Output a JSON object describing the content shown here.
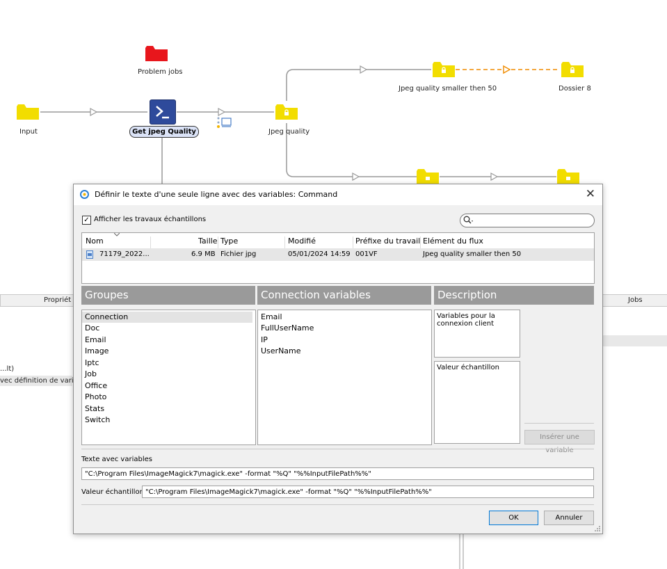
{
  "flow": {
    "problem_jobs": "Problem jobs",
    "input": "Input",
    "get_jpeg_quality": "Get jpeg Quality",
    "jpeg_quality": "Jpeg quality",
    "jpeg_smaller": "Jpeg quality smaller then 50",
    "dossier8": "Dossier 8"
  },
  "background": {
    "properties_header": "Propriét",
    "jobs_header": "Jobs",
    "left_text1": "...lt)",
    "left_text2": "vec définition de varia"
  },
  "dialog": {
    "title": "Définir le texte d'une seule ligne avec des variables: Command",
    "show_samples_label": "Afficher les travaux échantillons",
    "show_samples_checked": "✓",
    "search_placeholder": "",
    "columns": [
      "Nom",
      "Taille",
      "Type",
      "Modifié",
      "Préfixe du travail",
      "Elément du flux"
    ],
    "row": {
      "name": "71179_2022...",
      "size": "6.9 MB",
      "type": "Fichier jpg",
      "modified": "05/01/2024 14:59",
      "prefix": "001VF",
      "element": "Jpeg quality smaller then 50"
    },
    "groups_header": "Groupes",
    "variables_header": "Connection variables",
    "description_header": "Description",
    "groups": [
      "Connection",
      "Doc",
      "Email",
      "Image",
      "Iptc",
      "Job",
      "Office",
      "Photo",
      "Stats",
      "Switch"
    ],
    "variables": [
      "Email",
      "FullUserName",
      "IP",
      "UserName"
    ],
    "description_text": "Variables pour la connexion client",
    "sample_value_label": "Valeur échantillon",
    "insert_variable": "Insérer une variable",
    "text_with_variables_label": "Texte avec variables",
    "text_with_variables_value": "\"C:\\Program Files\\ImageMagick7\\magick.exe\" -format \"%Q\" \"%%InputFilePath%%\"",
    "sample_label": "Valeur échantillon",
    "sample_value": "\"C:\\Program Files\\ImageMagick7\\magick.exe\" -format \"%Q\" \"%%InputFilePath%%\"",
    "ok": "OK",
    "cancel": "Annuler"
  },
  "colors": {
    "folder_yellow": "#f2dd00",
    "folder_red": "#e8161c",
    "script_blue": "#2e4a9b",
    "accent_orange": "#f08c00"
  }
}
